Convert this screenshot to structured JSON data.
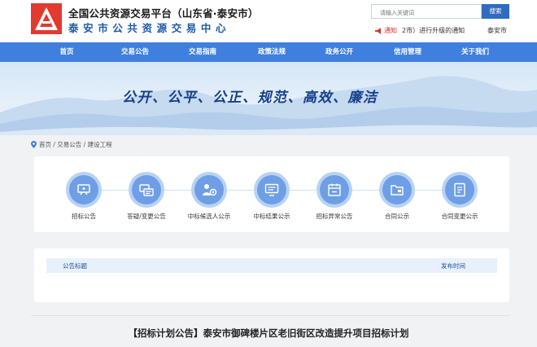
{
  "header": {
    "title_main": "全国公共资源交易平台（山东省·泰安市）",
    "title_sub": "泰安市公共资源交易中心",
    "search_placeholder": "请输入关键词",
    "search_button": "搜索"
  },
  "notice": {
    "tag": "通知",
    "text": "2市）进行升级的通知",
    "text2": "泰安市"
  },
  "nav": {
    "items": [
      "首页",
      "交易公告",
      "交易指南",
      "政策法规",
      "政务公开",
      "信用管理",
      "关于我们"
    ]
  },
  "banner": {
    "slogan": "公开、公平、公正、规范、高效、廉洁"
  },
  "breadcrumb": {
    "text": "首页 / 交易公告 / 建设工程"
  },
  "categories": {
    "items": [
      "招标公告",
      "答疑/变更公告",
      "中标候选人公示",
      "中标结果公示",
      "招标异常公告",
      "合同公示",
      "合同变更公示"
    ]
  },
  "list": {
    "col_title": "公告标题",
    "col_date": "发布时间"
  },
  "article": {
    "title": "【招标计划公告】泰安市御碑楼片区老旧街区改造提升项目招标计划"
  },
  "colors": {
    "nav_bg": "#3f7fdd",
    "brand_blue": "#1e5aa8",
    "logo_red": "#d9322b"
  }
}
